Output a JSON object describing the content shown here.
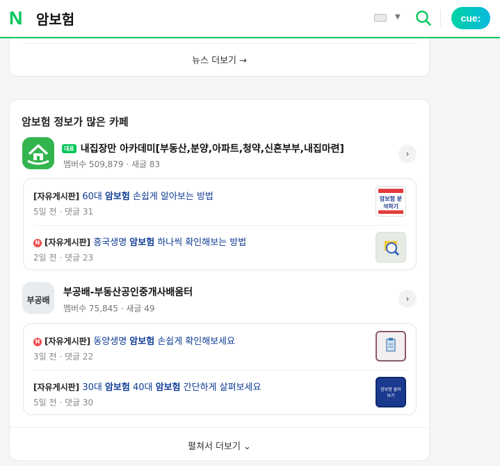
{
  "header": {
    "logo": "N",
    "query": "암보험",
    "cue_label": "cue:"
  },
  "news": {
    "more_label": "뉴스 더보기 →"
  },
  "cafe_section": {
    "title": "암보험 정보가 많은 카페",
    "expand_label": "펼쳐서 더보기 ⌄",
    "cafes": [
      {
        "badge": "대표",
        "name": "내집장만 아카데미[부동산,분양,아파트,청약,신혼부부,내집마련]",
        "meta": "멤버수 509,879 · 새글 83",
        "posts": [
          {
            "board": "[자유게시판]",
            "pre": "60대 ",
            "kw": "암보험",
            "rest": " 손쉽게 알아보는 방법",
            "meta": "5일 전 · 댓글 31",
            "new": false,
            "thumb_text": "암보험 분석하기"
          },
          {
            "board": "[자유게시판]",
            "pre": "흥국생명 ",
            "kw": "암보험",
            "rest": " 하나씩 확인해보는 방법",
            "meta": "2일 전 · 댓글 23",
            "new": true,
            "thumb_text": ""
          }
        ]
      },
      {
        "badge": "",
        "name": "부공배-부동산공인중개사배움터",
        "thumb_text": "부공배",
        "meta": "멤버수 75,845 · 새글 49",
        "posts": [
          {
            "board": "[자유게시판]",
            "pre": "동양생명 ",
            "kw": "암보험",
            "rest": " 손쉽게 확인해보세요",
            "meta": "3일 전 · 댓글 22",
            "new": true,
            "thumb_text": ""
          },
          {
            "board": "[자유게시판]",
            "pre": "30대 ",
            "kw": "암보험",
            "mid": " 40대 ",
            "kw2": "암보험",
            "rest": " 간단하게 살펴보세요",
            "meta": "5일 전 · 댓글 30",
            "new": false,
            "thumb_text": "암보험 둘러보기"
          }
        ]
      }
    ]
  },
  "colors": {
    "brand": "#03c75a",
    "keyword": "#0d3a94",
    "new_dot": "#f04b4b"
  }
}
